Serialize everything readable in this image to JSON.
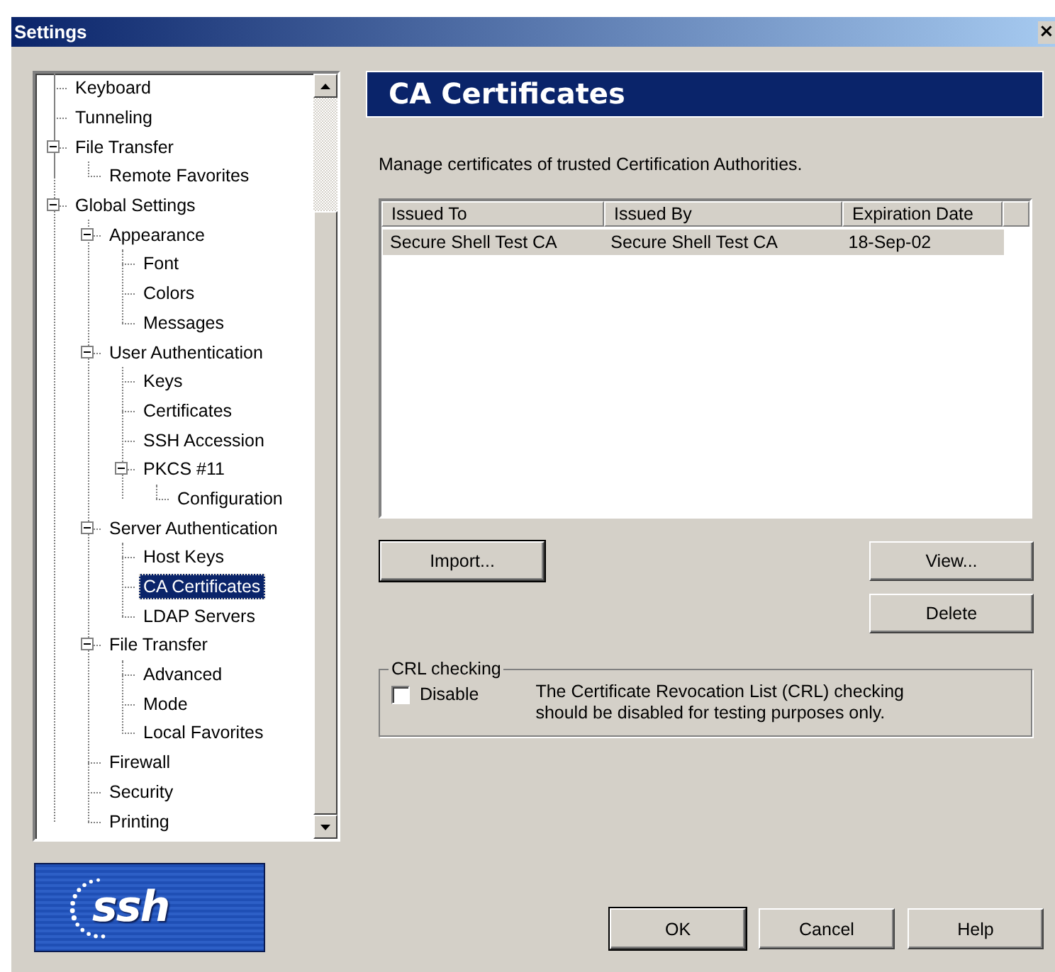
{
  "window": {
    "title": "Settings",
    "close": "×"
  },
  "tree": {
    "items": [
      {
        "children": [
          {
            "label": "Keyboard",
            "selected": false
          },
          {
            "label": "Tunneling",
            "selected": false
          },
          {
            "label": "File Transfer",
            "selected": false,
            "expanded": true,
            "children": [
              {
                "label": "Remote Favorites",
                "selected": false
              }
            ]
          }
        ]
      },
      {
        "label": "Global Settings",
        "selected": false,
        "expanded": true,
        "children": [
          {
            "label": "Appearance",
            "selected": false,
            "expanded": true,
            "children": [
              {
                "label": "Font",
                "selected": false
              },
              {
                "label": "Colors",
                "selected": false
              },
              {
                "label": "Messages",
                "selected": false
              }
            ]
          },
          {
            "label": "User Authentication",
            "selected": false,
            "expanded": true,
            "children": [
              {
                "label": "Keys",
                "selected": false
              },
              {
                "label": "Certificates",
                "selected": false
              },
              {
                "label": "SSH Accession",
                "selected": false
              },
              {
                "label": "PKCS #11",
                "selected": false,
                "expanded": true,
                "children": [
                  {
                    "label": "Configuration",
                    "selected": false
                  }
                ]
              }
            ]
          },
          {
            "label": "Server Authentication",
            "selected": false,
            "expanded": true,
            "children": [
              {
                "label": "Host Keys",
                "selected": false
              },
              {
                "label": "CA Certificates",
                "selected": true
              },
              {
                "label": "LDAP Servers",
                "selected": false
              }
            ]
          },
          {
            "label": "File Transfer",
            "selected": false,
            "expanded": true,
            "children": [
              {
                "label": "Advanced",
                "selected": false
              },
              {
                "label": "Mode",
                "selected": false
              },
              {
                "label": "Local Favorites",
                "selected": false
              }
            ]
          },
          {
            "label": "Firewall",
            "selected": false
          },
          {
            "label": "Security",
            "selected": false
          },
          {
            "label": "Printing",
            "selected": false
          }
        ]
      }
    ]
  },
  "logo": {
    "text": "ssh"
  },
  "panel": {
    "title": "CA Certificates",
    "description": "Manage certificates of trusted Certification Authorities.",
    "table": {
      "columns": [
        "Issued To",
        "Issued By",
        "Expiration Date"
      ],
      "rows": [
        {
          "cells": [
            "Secure Shell Test CA",
            "Secure Shell Test CA",
            "18-Sep-02"
          ],
          "selected": true
        }
      ]
    },
    "buttons": [
      "Import...",
      "View...",
      "Delete"
    ],
    "crl": {
      "title": "CRL checking",
      "checkbox": {
        "label": "Disable",
        "checked": false
      },
      "note": "The Certificate Revocation List (CRL) checking should be disabled for testing purposes only."
    }
  },
  "dialog_buttons": [
    {
      "label": "OK",
      "default": true
    },
    {
      "label": "Cancel",
      "default": false
    },
    {
      "label": "Help",
      "default": false
    }
  ]
}
